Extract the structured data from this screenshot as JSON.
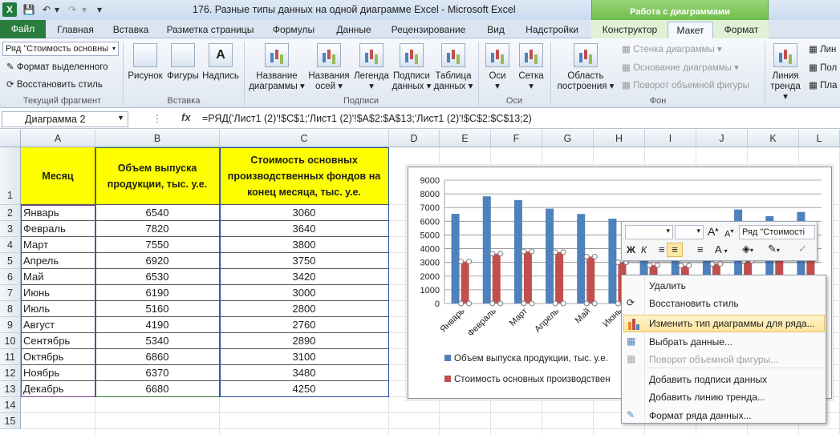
{
  "window": {
    "title": "176. Разные типы данных на одной диаграмме Excel  -  Microsoft Excel",
    "context_header": "Работа с диаграммами",
    "logo": "X"
  },
  "tabs": [
    "Файл",
    "Главная",
    "Вставка",
    "Разметка страницы",
    "Формулы",
    "Данные",
    "Рецензирование",
    "Вид",
    "Надстройки",
    "Конструктор",
    "Макет",
    "Формат"
  ],
  "active_tab": "Макет",
  "ribbon": {
    "current_selection": {
      "series_select": "Ряд \"Стоимость основны",
      "format_selection": "Формат выделенного",
      "reset_style": "Восстановить стиль",
      "group": "Текущий фрагмент"
    },
    "insert": {
      "picture": "Рисунок",
      "shapes": "Фигуры",
      "textbox": "Надпись",
      "group": "Вставка"
    },
    "labels": {
      "chart_title": [
        "Название",
        "диаграммы ▾"
      ],
      "axis_titles": [
        "Названия",
        "осей ▾"
      ],
      "legend": [
        "Легенда",
        "▾"
      ],
      "data_labels": [
        "Подписи",
        "данных ▾"
      ],
      "data_table": [
        "Таблица",
        "данных ▾"
      ],
      "group": "Подписи"
    },
    "axes": {
      "axes": [
        "Оси",
        "▾"
      ],
      "gridlines": [
        "Сетка",
        "▾"
      ],
      "group": "Оси"
    },
    "background": {
      "plot_area": [
        "Область",
        "построения ▾"
      ],
      "chart_wall": "Стенка диаграммы ▾",
      "chart_floor": "Основание диаграммы ▾",
      "rotation": "Поворот объемной фигуры",
      "group": "Фон"
    },
    "analysis": {
      "trendline": [
        "Линия",
        "тренда ▾"
      ],
      "lin": "Лин",
      "up": "Пол",
      "pla": "Пла"
    }
  },
  "formula_bar": {
    "name_box": "Диаграмма 2",
    "fx": "fx",
    "formula": "=РЯД('Лист1 (2)'!$C$1;'Лист1 (2)'!$A$2:$A$13;'Лист1 (2)'!$C$2:$C$13;2)"
  },
  "columns": [
    "A",
    "B",
    "C",
    "D",
    "E",
    "F",
    "G",
    "H",
    "I",
    "J",
    "K",
    "L"
  ],
  "rows": [
    "1",
    "2",
    "3",
    "4",
    "5",
    "6",
    "7",
    "8",
    "9",
    "10",
    "11",
    "12",
    "13",
    "14",
    "15"
  ],
  "table": {
    "headers": [
      "Месяц",
      "Объем выпуска продукции, тыс. у.е.",
      "Стоимость основных производственных фондов на конец месяца, тыс. у.е."
    ],
    "rows": [
      [
        "Январь",
        "6540",
        "3060"
      ],
      [
        "Февраль",
        "7820",
        "3640"
      ],
      [
        "Март",
        "7550",
        "3800"
      ],
      [
        "Апрель",
        "6920",
        "3750"
      ],
      [
        "Май",
        "6530",
        "3420"
      ],
      [
        "Июнь",
        "6190",
        "3000"
      ],
      [
        "Июль",
        "5160",
        "2800"
      ],
      [
        "Август",
        "4190",
        "2760"
      ],
      [
        "Сентябрь",
        "5340",
        "2890"
      ],
      [
        "Октябрь",
        "6860",
        "3100"
      ],
      [
        "Ноябрь",
        "6370",
        "3480"
      ],
      [
        "Декабрь",
        "6680",
        "4250"
      ]
    ]
  },
  "chart_data": {
    "type": "bar",
    "categories": [
      "Январь",
      "Февраль",
      "Март",
      "Апрель",
      "Май",
      "Июнь",
      "Июль",
      "Август",
      "Сентябрь",
      "Октябрь",
      "Ноябрь",
      "Декабрь"
    ],
    "visible_tick_labels": [
      "Январь",
      "Февраль",
      "Март",
      "Апрель",
      "Май",
      "Июнь"
    ],
    "series": [
      {
        "name": "Объем выпуска продукции,  тыс. у.е.",
        "color": "#4f81bd",
        "values": [
          6540,
          7820,
          7550,
          6920,
          6530,
          6190,
          5160,
          4190,
          5340,
          6860,
          6370,
          6680
        ]
      },
      {
        "name": "Стоимость основных производствен",
        "color": "#c0504d",
        "values": [
          3060,
          3640,
          3800,
          3750,
          3420,
          3000,
          2800,
          2760,
          2890,
          3100,
          3480,
          4250
        ]
      }
    ],
    "ylim": [
      0,
      9000
    ],
    "yticks": [
      "9000",
      "8000",
      "7000",
      "6000",
      "5000",
      "4000",
      "3000",
      "2000",
      "1000",
      "0"
    ],
    "gridlines": true,
    "selected_series": 2,
    "legend_position": "bottom"
  },
  "mini_toolbar": {
    "series_select": "Ряд \"Стоимості",
    "bold": "Ж",
    "italic": "К",
    "grow": "A",
    "shrink": "A",
    "font_color": "A"
  },
  "context_menu": {
    "items": [
      {
        "label": "Удалить",
        "disabled": false,
        "icon": ""
      },
      {
        "label": "Восстановить стиль",
        "disabled": false,
        "icon": "reset-style-icon"
      },
      {
        "label": "Изменить тип диаграммы для ряда...",
        "disabled": false,
        "icon": "chart-type-icon",
        "highlighted": true
      },
      {
        "label": "Выбрать данные...",
        "disabled": false,
        "icon": "select-data-icon"
      },
      {
        "label": "Поворот объемной фигуры...",
        "disabled": true,
        "icon": "rotation-icon"
      },
      {
        "label": "Добавить подписи данных",
        "disabled": false,
        "icon": ""
      },
      {
        "label": "Добавить линию тренда...",
        "disabled": false,
        "icon": ""
      },
      {
        "label": "Формат ряда данных...",
        "disabled": false,
        "icon": "format-series-icon"
      }
    ]
  }
}
